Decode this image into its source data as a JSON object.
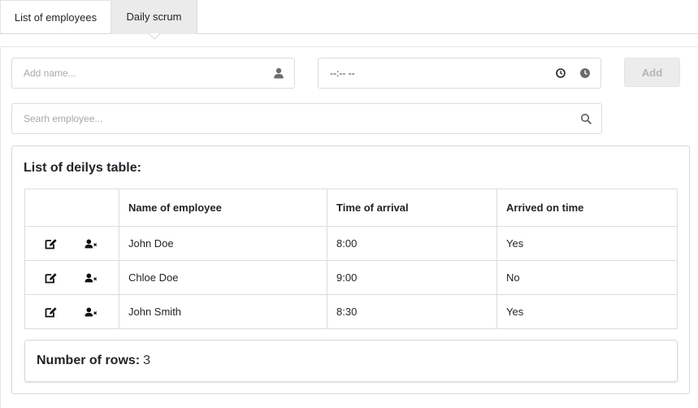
{
  "tabs": [
    {
      "label": "List of employees",
      "active": false
    },
    {
      "label": "Daily scrum",
      "active": true
    }
  ],
  "form": {
    "name_placeholder": "Add name...",
    "time_value": "--:-- --",
    "add_label": "Add",
    "search_placeholder": "Searh employee..."
  },
  "table": {
    "title": "List of deilys table:",
    "headers": [
      "",
      "Name of employee",
      "Time of arrival",
      "Arrived on time"
    ],
    "rows": [
      {
        "name": "John Doe",
        "time": "8:00",
        "on_time": "Yes"
      },
      {
        "name": "Chloe Doe",
        "time": "9:00",
        "on_time": "No"
      },
      {
        "name": "John Smith",
        "time": "8:30",
        "on_time": "Yes"
      }
    ],
    "row_icons": [
      "edit-icon",
      "remove-user-icon"
    ]
  },
  "summary": {
    "label": "Number of rows:",
    "value": "3"
  },
  "colors": {
    "active_tab_bg": "#ebebeb",
    "border": "#dcdcdc",
    "disabled_button_bg": "#ececec",
    "icon": "#6c6c6c"
  }
}
